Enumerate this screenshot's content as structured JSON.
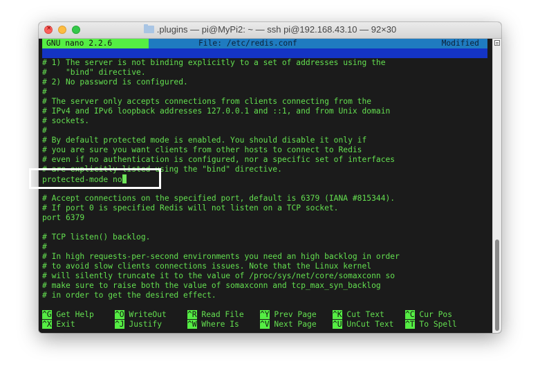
{
  "window": {
    "title": ".plugins — pi@MyPi2: ~ — ssh pi@192.168.43.10 — 92×30",
    "folder_icon": "folder-icon",
    "close_glyph": "×"
  },
  "nano": {
    "version": "GNU nano 2.2.6",
    "file": "File: /etc/redis.conf",
    "status": "Modified"
  },
  "lines": [
    "# 1) The server is not binding explicitly to a set of addresses using the",
    "#    \"bind\" directive.",
    "# 2) No password is configured.",
    "#",
    "# The server only accepts connections from clients connecting from the",
    "# IPv4 and IPv6 loopback addresses 127.0.0.1 and ::1, and from Unix domain",
    "# sockets.",
    "#",
    "# By default protected mode is enabled. You should disable it only if",
    "# you are sure you want clients from other hosts to connect to Redis",
    "# even if no authentication is configured, nor a specific set of interfaces",
    "# are explicitly listed using the \"bind\" directive.",
    "protected-mode no",
    "",
    "# Accept connections on the specified port, default is 6379 (IANA #815344).",
    "# If port 0 is specified Redis will not listen on a TCP socket.",
    "port 6379",
    "",
    "# TCP listen() backlog.",
    "#",
    "# In high requests-per-second environments you need an high backlog in order",
    "# to avoid slow clients connections issues. Note that the Linux kernel",
    "# will silently truncate it to the value of /proc/sys/net/core/somaxconn so",
    "# make sure to raise both the value of somaxconn and tcp_max_syn_backlog",
    "# in order to get the desired effect."
  ],
  "shortcuts": [
    {
      "key": "^G",
      "label": "Get Help"
    },
    {
      "key": "^O",
      "label": "WriteOut"
    },
    {
      "key": "^R",
      "label": "Read File"
    },
    {
      "key": "^Y",
      "label": "Prev Page"
    },
    {
      "key": "^K",
      "label": "Cut Text"
    },
    {
      "key": "^C",
      "label": "Cur Pos"
    },
    {
      "key": "^X",
      "label": "Exit"
    },
    {
      "key": "^J",
      "label": "Justify"
    },
    {
      "key": "^W",
      "label": "Where Is"
    },
    {
      "key": "^V",
      "label": "Next Page"
    },
    {
      "key": "^U",
      "label": "UnCut Text"
    },
    {
      "key": "^T",
      "label": "To Spell"
    }
  ],
  "colors": {
    "terminal_bg": "#1b1b1b",
    "text": "#64e050",
    "titlebar_bar": "#1f7bc0",
    "version_bg": "#55ee44",
    "blank_bar": "#1434c4",
    "highlight_box": "#ffffff"
  }
}
